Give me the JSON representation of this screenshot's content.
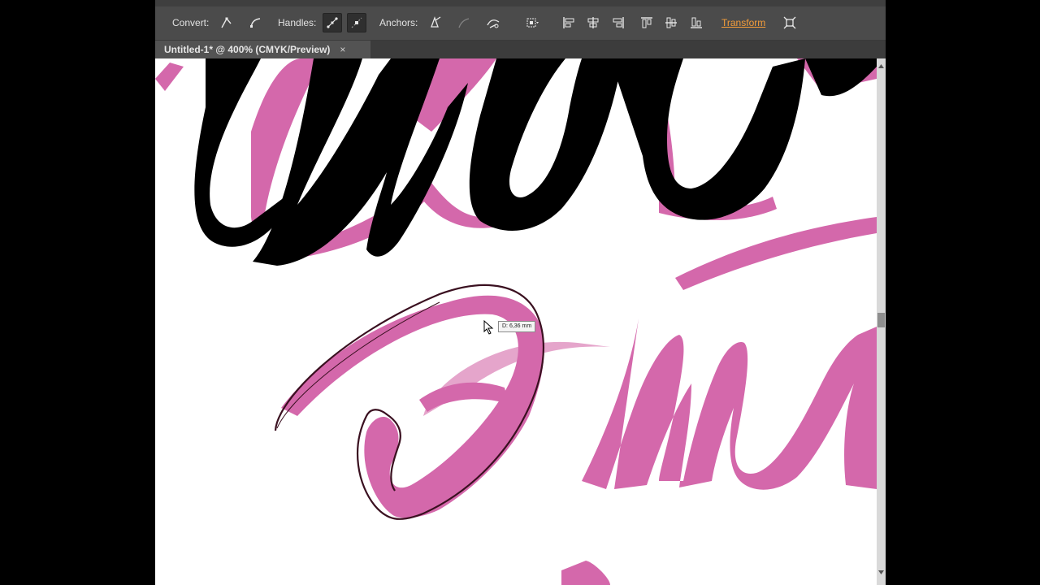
{
  "control_bar": {
    "convert_label": "Convert:",
    "handles_label": "Handles:",
    "anchors_label": "Anchors:",
    "transform_label": "Transform"
  },
  "document_tab": {
    "title": "Untitled-1* @ 400% (CMYK/Preview)",
    "close_glyph": "×"
  },
  "tooltip": {
    "distance": "D: 6,36 mm"
  },
  "colors": {
    "accent": "#f39c3a",
    "artwork_pink": "#d468ab",
    "artwork_black": "#000000",
    "path_outline": "#3a1020"
  },
  "icons": [
    "convert-corner-icon",
    "convert-smooth-icon",
    "show-handles-icon",
    "hide-handles-icon",
    "remove-anchor-icon",
    "connect-anchor-icon",
    "cut-path-icon",
    "align-to-icon",
    "align-left-icon",
    "align-center-icon",
    "align-right-icon",
    "align-top-icon",
    "align-middle-icon",
    "align-bottom-icon",
    "isolate-icon"
  ]
}
